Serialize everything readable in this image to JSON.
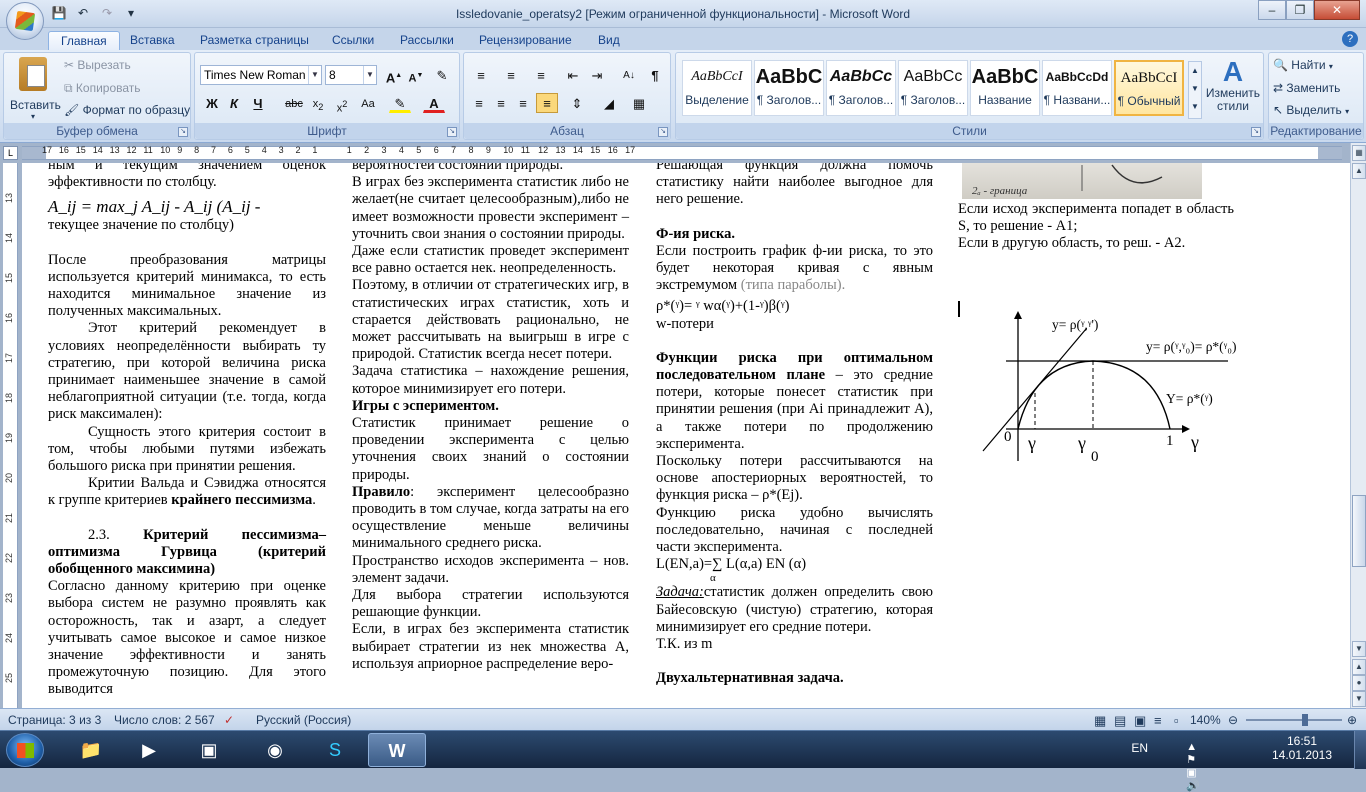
{
  "window": {
    "title": "Issledovanie_operatsy2 [Режим ограниченной функциональности] - Microsoft Word"
  },
  "qat": {
    "save_icon": "save-icon",
    "undo_icon": "undo-icon",
    "redo_icon": "redo-icon",
    "customize_icon": "customize-icon"
  },
  "tabs": [
    {
      "label": "Главная"
    },
    {
      "label": "Вставка"
    },
    {
      "label": "Разметка страницы"
    },
    {
      "label": "Ссылки"
    },
    {
      "label": "Рассылки"
    },
    {
      "label": "Рецензирование"
    },
    {
      "label": "Вид"
    }
  ],
  "clipboard": {
    "paste": "Вставить",
    "cut": "Вырезать",
    "copy": "Копировать",
    "format_painter": "Формат по образцу",
    "label": "Буфер обмена"
  },
  "font": {
    "name": "Times New Roman",
    "size": "8",
    "label": "Шрифт"
  },
  "paragraph": {
    "label": "Абзац"
  },
  "styles": {
    "label": "Стили",
    "items": [
      {
        "sample": "AaBbCcI",
        "name": "Выделение"
      },
      {
        "sample": "AaBbC",
        "name": "¶ Заголов..."
      },
      {
        "sample": "AaBbCc",
        "name": "¶ Заголов..."
      },
      {
        "sample": "AaBbCc",
        "name": "¶ Заголов..."
      },
      {
        "sample": "AaBbC",
        "name": "Название"
      },
      {
        "sample": "AaBbCcDd",
        "name": "¶ Названи..."
      },
      {
        "sample": "AaBbCcI",
        "name": "¶ Обычный"
      }
    ],
    "change_styles": "Изменить стили"
  },
  "editing": {
    "find": "Найти",
    "replace": "Заменить",
    "select": "Выделить",
    "label": "Редактирование"
  },
  "ruler": {
    "left_ticks": [
      "17",
      "16",
      "15",
      "14",
      "13",
      "12",
      "11",
      "10",
      "9",
      "8",
      "7",
      "6",
      "5",
      "4",
      "3",
      "2",
      "1"
    ],
    "right_ticks": [
      "1",
      "2",
      "3",
      "4",
      "5",
      "6",
      "7",
      "8",
      "9",
      "10",
      "11",
      "12",
      "13",
      "14",
      "15",
      "16",
      "17"
    ],
    "tab_symbol": "L"
  },
  "doc": {
    "col1": {
      "p0": "ным и текущим значением оценок эффективности по столбцу.",
      "formula": "A_ij = max_j A_ij - A_ij (A_ij -",
      "p0b": "текущее значение по столбцу)",
      "p1": "После преобразования матрицы используется критерий минимакса, то есть находится минимальное значение из полученных максимальных.",
      "p2": "Этот критерий рекомендует в условиях неопределённости выбирать ту стратегию, при которой величина риска принимает наименьшее значение в самой неблагоприятной ситуации (т.е. тогда, когда риск максимален):",
      "p3": "Сущность этого критерия состоит в том, чтобы любыми путями избежать большого риска при принятии решения.",
      "p4a": "Критии Вальда и Сэвиджа относятся к группе критериев ",
      "p4b": "крайнего пессимизма",
      "p4c": ".",
      "h1a": "2.3. ",
      "h1b": "Критерий пессимизма–оптимизма Гурвица (критерий обобщенного максимина)",
      "p5": "Согласно данному критерию при оценке выбора систем не разумно проявлять как осторожность, так и азарт, а следует учитывать самое высокое и самое низкое значение эффективности и занять промежуточную позицию. Для этого выводится"
    },
    "col2": {
      "p0": "вероятностей состоянии природы.",
      "p1": "В играх без эксперимента статистик либо не желает(не считает целесообразным),либо не имеет возможности провести эксперимент – уточнить свои знания о состоянии природы.",
      "p2": "Даже если статистик проведет эксперимент все равно остается нек. неопределенность.",
      "p3": "Поэтому, в отличии от стратегических игр, в статистических играх статистик, хоть и старается действовать рационально, не может рассчитывать на выигрыш в игре с природой. Статистик всегда несет потери.",
      "p4": "Задача статистика – нахождение решения, которое минимизирует его потери.",
      "h1": "Игры с эспериментом.",
      "p5": "Статистик принимает решение о проведении эксперимента с целью уточнения своих знаний о состоянии природы.",
      "p6a": "Правило",
      "p6b": ": эксперимент целесообразно проводить в том случае, когда затраты на его осуществление меньше величины минимального среднего риска.",
      "p7": "Пространство исходов эксперимента – нов. элемент задачи.",
      "p8": "Для выбора стратегии используются решающие функции.",
      "p9": "Если, в играх без эксперимента статистик выбирает стратегии из нек множества А, используя априорное распределение веро-"
    },
    "col3": {
      "p0": "Решающая функция должна помочь статистику найти наиболее выгодное для него решение.",
      "h1": "Ф-ия риска.",
      "p1a": "Если построить график ф-ии риска, то это будет некоторая кривая с явным экстремумом ",
      "p1b": "(типа параболы).",
      "f1": "ρ*(ᵞ)= ᵞ wα(ᵞ)+(1-ᵞ)β(ᵞ)",
      "f2": "w-потери",
      "h2": "Функции риска при оптимальном последовательном плане",
      "p2": " – это средние потери, которые понесет статистик при принятии решения (при Ai принадлежит A), а также потери по продолжению эксперимента.",
      "p3": "Поскольку потери рассчитываются на основе апостериорных вероятностей, то функция риска – ρ*(Ej).",
      "p4": "Функцию риска удобно вычислять последовательно, начиная с последней части эксперимента.",
      "f3": "L(EN,a)=∑ L(α,a) EN (α)",
      "f3sub": "α",
      "p5a": "Задача:",
      "p5b": "статистик должен определить свою Байесовскую (чистую) стратегию, которая минимизирует его средние потери.",
      "p6": "Т.К. из m",
      "h3": "Двухальтернативная задача."
    },
    "col4": {
      "img_caption": "2ₐ - граница",
      "p1": "Если исход эксперимента попадет в область S, то решение - A1;",
      "p2": "Если в другую область, то реш. - A2.",
      "graph": {
        "label_tangent": "y= ρ(ᵞ,ᵞ')",
        "label_level": "y= ρ(ᵞ,ᵞ₀)= ρ*(ᵞ₀)",
        "label_curve": "Y= ρ*(ᵞ)",
        "x_zero": "0",
        "x_gamma": "γ",
        "x_gamma0": "γ",
        "x_gamma0_sub": "0",
        "x_one": "1",
        "x_axis": "γ"
      }
    }
  },
  "status": {
    "page": "Страница: 3 из 3",
    "words": "Число слов: 2 567",
    "lang": "Русский (Россия)",
    "zoom": "140%"
  },
  "taskbar": {
    "lang": "EN",
    "time": "16:51",
    "date": "14.01.2013"
  }
}
